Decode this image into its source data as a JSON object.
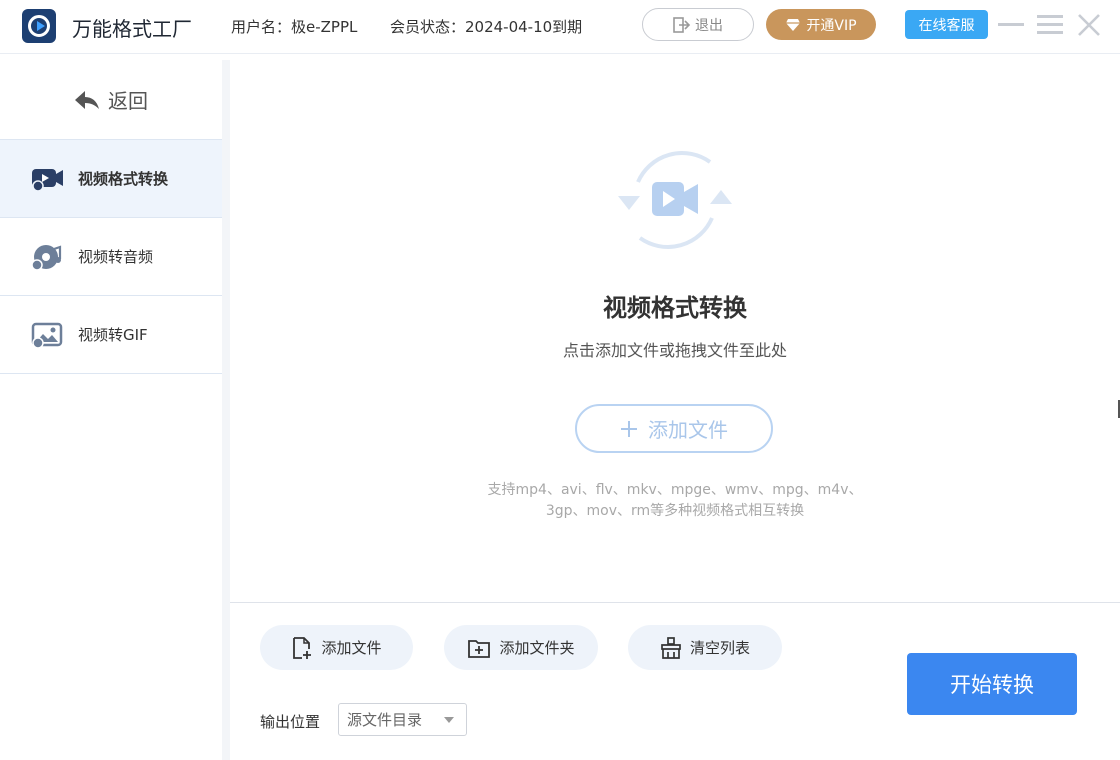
{
  "app": {
    "name": "万能格式工厂",
    "user_label": "用户名：极e-ZPPL",
    "vip_status": "会员状态：2024-04-10到期",
    "logout_label": "退出",
    "vip_button_label": "开通VIP",
    "service_label": "在线客服",
    "colors": {
      "brand": "#1d3f72",
      "accent": "#3b87f0",
      "vip": "#c9965c",
      "service": "#3aa8f4"
    }
  },
  "sidebar": {
    "back_label": "返回",
    "items": [
      {
        "label": "视频格式转换",
        "icon": "video-convert-icon",
        "active": true
      },
      {
        "label": "视频转音频",
        "icon": "video-to-audio-icon",
        "active": false
      },
      {
        "label": "视频转GIF",
        "icon": "video-to-gif-icon",
        "active": false
      }
    ]
  },
  "main": {
    "title": "视频格式转换",
    "subtitle": "点击添加文件或拖拽文件至此处",
    "add_file_label": "添加文件",
    "formats_line1": "支持mp4、avi、flv、mkv、mpge、wmv、mpg、m4v、",
    "formats_line2": "3gp、mov、rm等多种视频格式相互转换"
  },
  "toolbar": {
    "add_file": "添加文件",
    "add_folder": "添加文件夹",
    "clear_list": "清空列表",
    "output_label": "输出位置",
    "output_value": "源文件目录",
    "start_label": "开始转换"
  }
}
